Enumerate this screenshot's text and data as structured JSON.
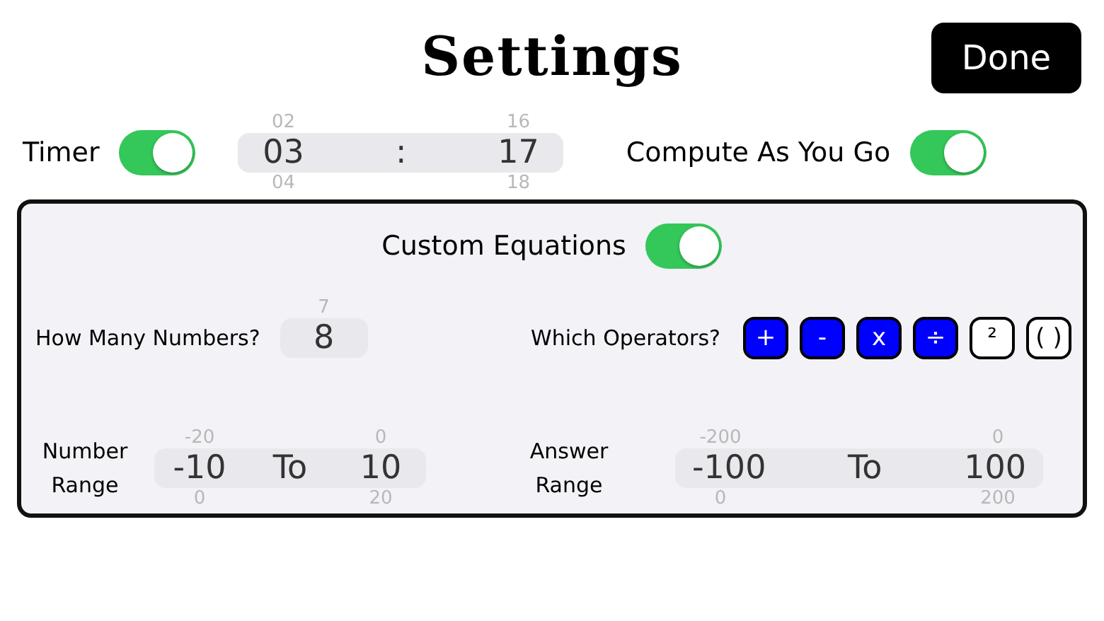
{
  "title": "Settings",
  "done_button": "Done",
  "timer": {
    "label": "Timer",
    "on": true,
    "picker": [
      {
        "above": "02",
        "value": "03",
        "below": "04"
      },
      {
        "value": ":"
      },
      {
        "above": "16",
        "value": "17",
        "below": "18"
      }
    ]
  },
  "compute_as_you_go": {
    "label": "Compute As You Go",
    "on": true
  },
  "custom_equations": {
    "label": "Custom Equations",
    "on": true
  },
  "how_many_numbers": {
    "label": "How Many Numbers?",
    "picker": [
      {
        "above": "7",
        "value": "8"
      }
    ]
  },
  "operators": {
    "label": "Which Operators?",
    "buttons": [
      {
        "symbol": "+",
        "selected": true
      },
      {
        "symbol": "-",
        "selected": true
      },
      {
        "symbol": "x",
        "selected": true
      },
      {
        "symbol": "÷",
        "selected": true
      },
      {
        "symbol": "²",
        "selected": false
      },
      {
        "symbol": "( )",
        "selected": false
      }
    ]
  },
  "number_range": {
    "label": "Number Range",
    "picker": [
      {
        "above": "-20",
        "value": "-10",
        "below": "0"
      },
      {
        "value": "To"
      },
      {
        "above": "0",
        "value": "10",
        "below": "20"
      }
    ]
  },
  "answer_range": {
    "label": "Answer Range",
    "picker": [
      {
        "above": "-200",
        "value": "-100",
        "below": "0"
      },
      {
        "value": "To"
      },
      {
        "above": "0",
        "value": "100",
        "below": "200"
      }
    ]
  }
}
